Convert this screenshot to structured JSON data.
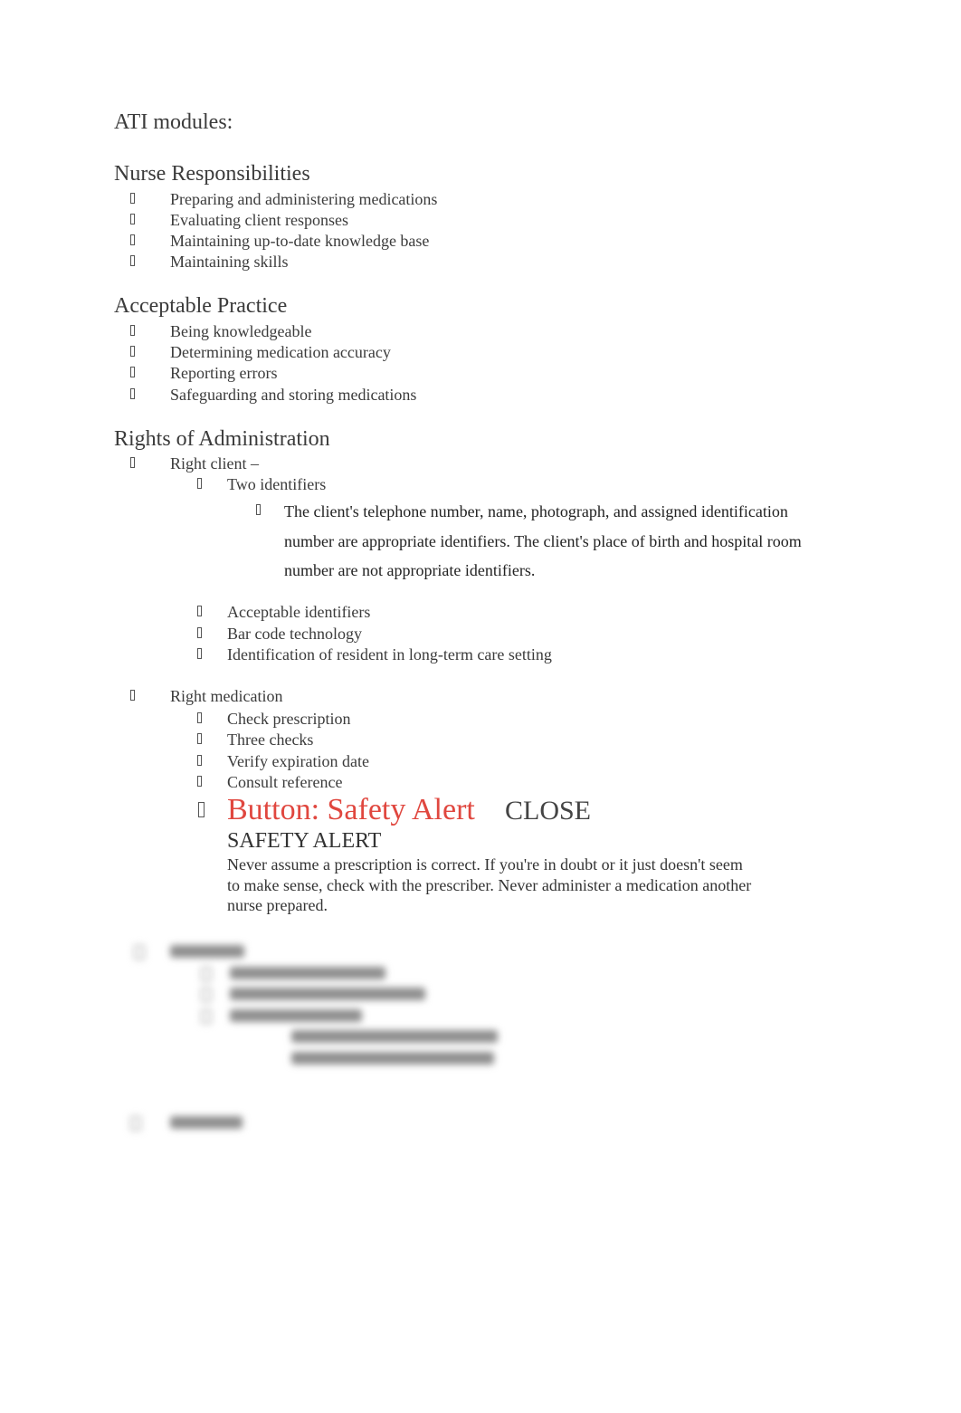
{
  "document": {
    "title": "ATI modules:",
    "sections": [
      {
        "heading": "Nurse Responsibilities",
        "items": [
          "Preparing and administering medications",
          "Evaluating client responses",
          "Maintaining up-to-date knowledge base",
          "Maintaining skills"
        ]
      },
      {
        "heading": "Acceptable Practice",
        "items": [
          "Being knowledgeable",
          "Determining medication accuracy",
          "Reporting errors",
          "Safeguarding and storing medications"
        ]
      },
      {
        "heading": "Rights of Administration",
        "right_client": {
          "label": "Right client –",
          "sub_items": [
            "Two identifiers",
            "Acceptable identifiers",
            "Bar code technology",
            "Identification of resident in long-term care setting"
          ],
          "note": "The client's telephone number, name, photograph, and assigned identification number are appropriate identifiers. The client's place of birth and hospital room number are not appropriate identifiers."
        },
        "right_medication": {
          "label": "Right medication",
          "sub_items": [
            "Check prescription",
            "Three checks",
            "Verify expiration date",
            "Consult reference"
          ],
          "safety_alert": {
            "button_label": "Button: Safety Alert",
            "close_label": "CLOSE",
            "title": "SAFETY ALERT",
            "body": "Never assume a prescription is correct. If you're in doubt or it just doesn't seem to make sense, check with the prescriber. Never administer a medication another nurse prepared."
          }
        }
      }
    ],
    "blurred_preview": {
      "note": "Remaining content is blurred (preview locked)"
    }
  },
  "colors": {
    "alert_button": "#e0473f",
    "text": "#3b3b3b"
  }
}
